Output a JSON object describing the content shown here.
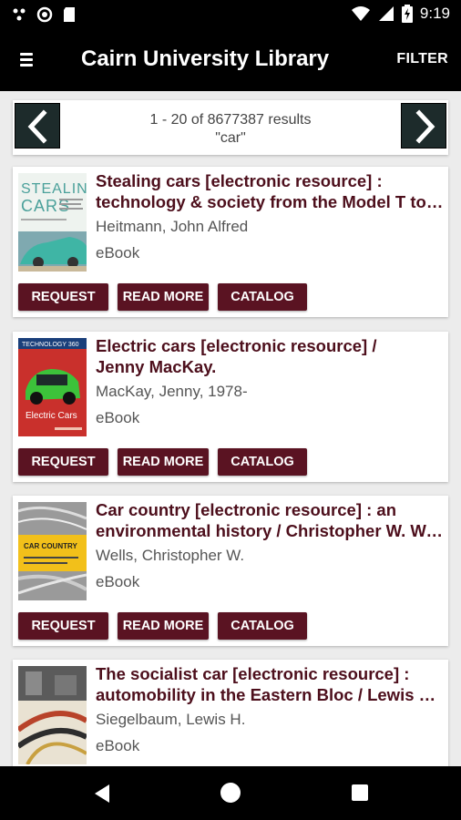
{
  "status": {
    "time": "9:19",
    "icons": [
      "notification-dots-icon",
      "sync-icon",
      "sd-card-icon",
      "wifi-icon",
      "signal-icon",
      "battery-icon"
    ]
  },
  "app": {
    "title": "Cairn University Library",
    "filter_label": "FILTER",
    "bar_color": "#000000",
    "accent": "#5a1322",
    "title_color": "#4d0f1c"
  },
  "pager": {
    "results_text": "1 - 20 of 8677387 results",
    "query_text": "\"car\""
  },
  "results": [
    {
      "title_line1": "Stealing cars [electronic resource] :",
      "title_line2": "technology & society from the Model T to the Gran Torino",
      "author": "Heitmann, John Alfred",
      "format": "eBook",
      "cover_text": "STEALING CARS"
    },
    {
      "title_line1": "Electric cars [electronic resource] /",
      "title_line2": "Jenny MacKay.",
      "author": "MacKay, Jenny, 1978-",
      "format": "eBook",
      "cover_text": "Electric Cars"
    },
    {
      "title_line1": "Car country [electronic resource] : an",
      "title_line2": "environmental history / Christopher W. Wells",
      "author": "Wells, Christopher W.",
      "format": "eBook",
      "cover_text": "CAR COUNTRY"
    },
    {
      "title_line1": "The socialist car [electronic resource] :",
      "title_line2": "automobility in the Eastern Bloc / Lewis H. Siegelbaum",
      "author": "Siegelbaum, Lewis H.",
      "format": "eBook",
      "cover_text": ""
    }
  ],
  "actions": {
    "request": "REQUEST",
    "read_more": "READ MORE",
    "catalog": "CATALOG"
  }
}
